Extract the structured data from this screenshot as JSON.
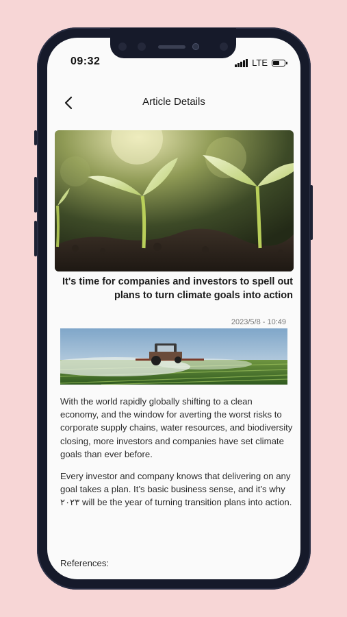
{
  "status": {
    "time": "09:32",
    "network": "LTE",
    "battery_level": 0.6
  },
  "nav": {
    "title": "Article Details",
    "back_icon": "chevron-left-icon"
  },
  "article": {
    "headline": "It's time for companies and investors to spell out plans to turn climate goals into action",
    "datetime": "2023/5/8 - 10:49",
    "paragraphs": [
      "With the world rapidly globally shifting to a clean economy, and the window for averting the worst risks to corporate supply chains, water resources, and biodiversity closing, more investors and companies have set climate goals than ever before.",
      "Every investor and company knows that delivering on any goal takes a plan. It’s basic business sense, and it’s why ٢٠٢٣ will be the year of turning transition plans into action."
    ],
    "references_label": "References:"
  },
  "colors": {
    "background": "#f7d6d6",
    "phone_frame": "#161a2a",
    "screen": "#fafafa"
  }
}
